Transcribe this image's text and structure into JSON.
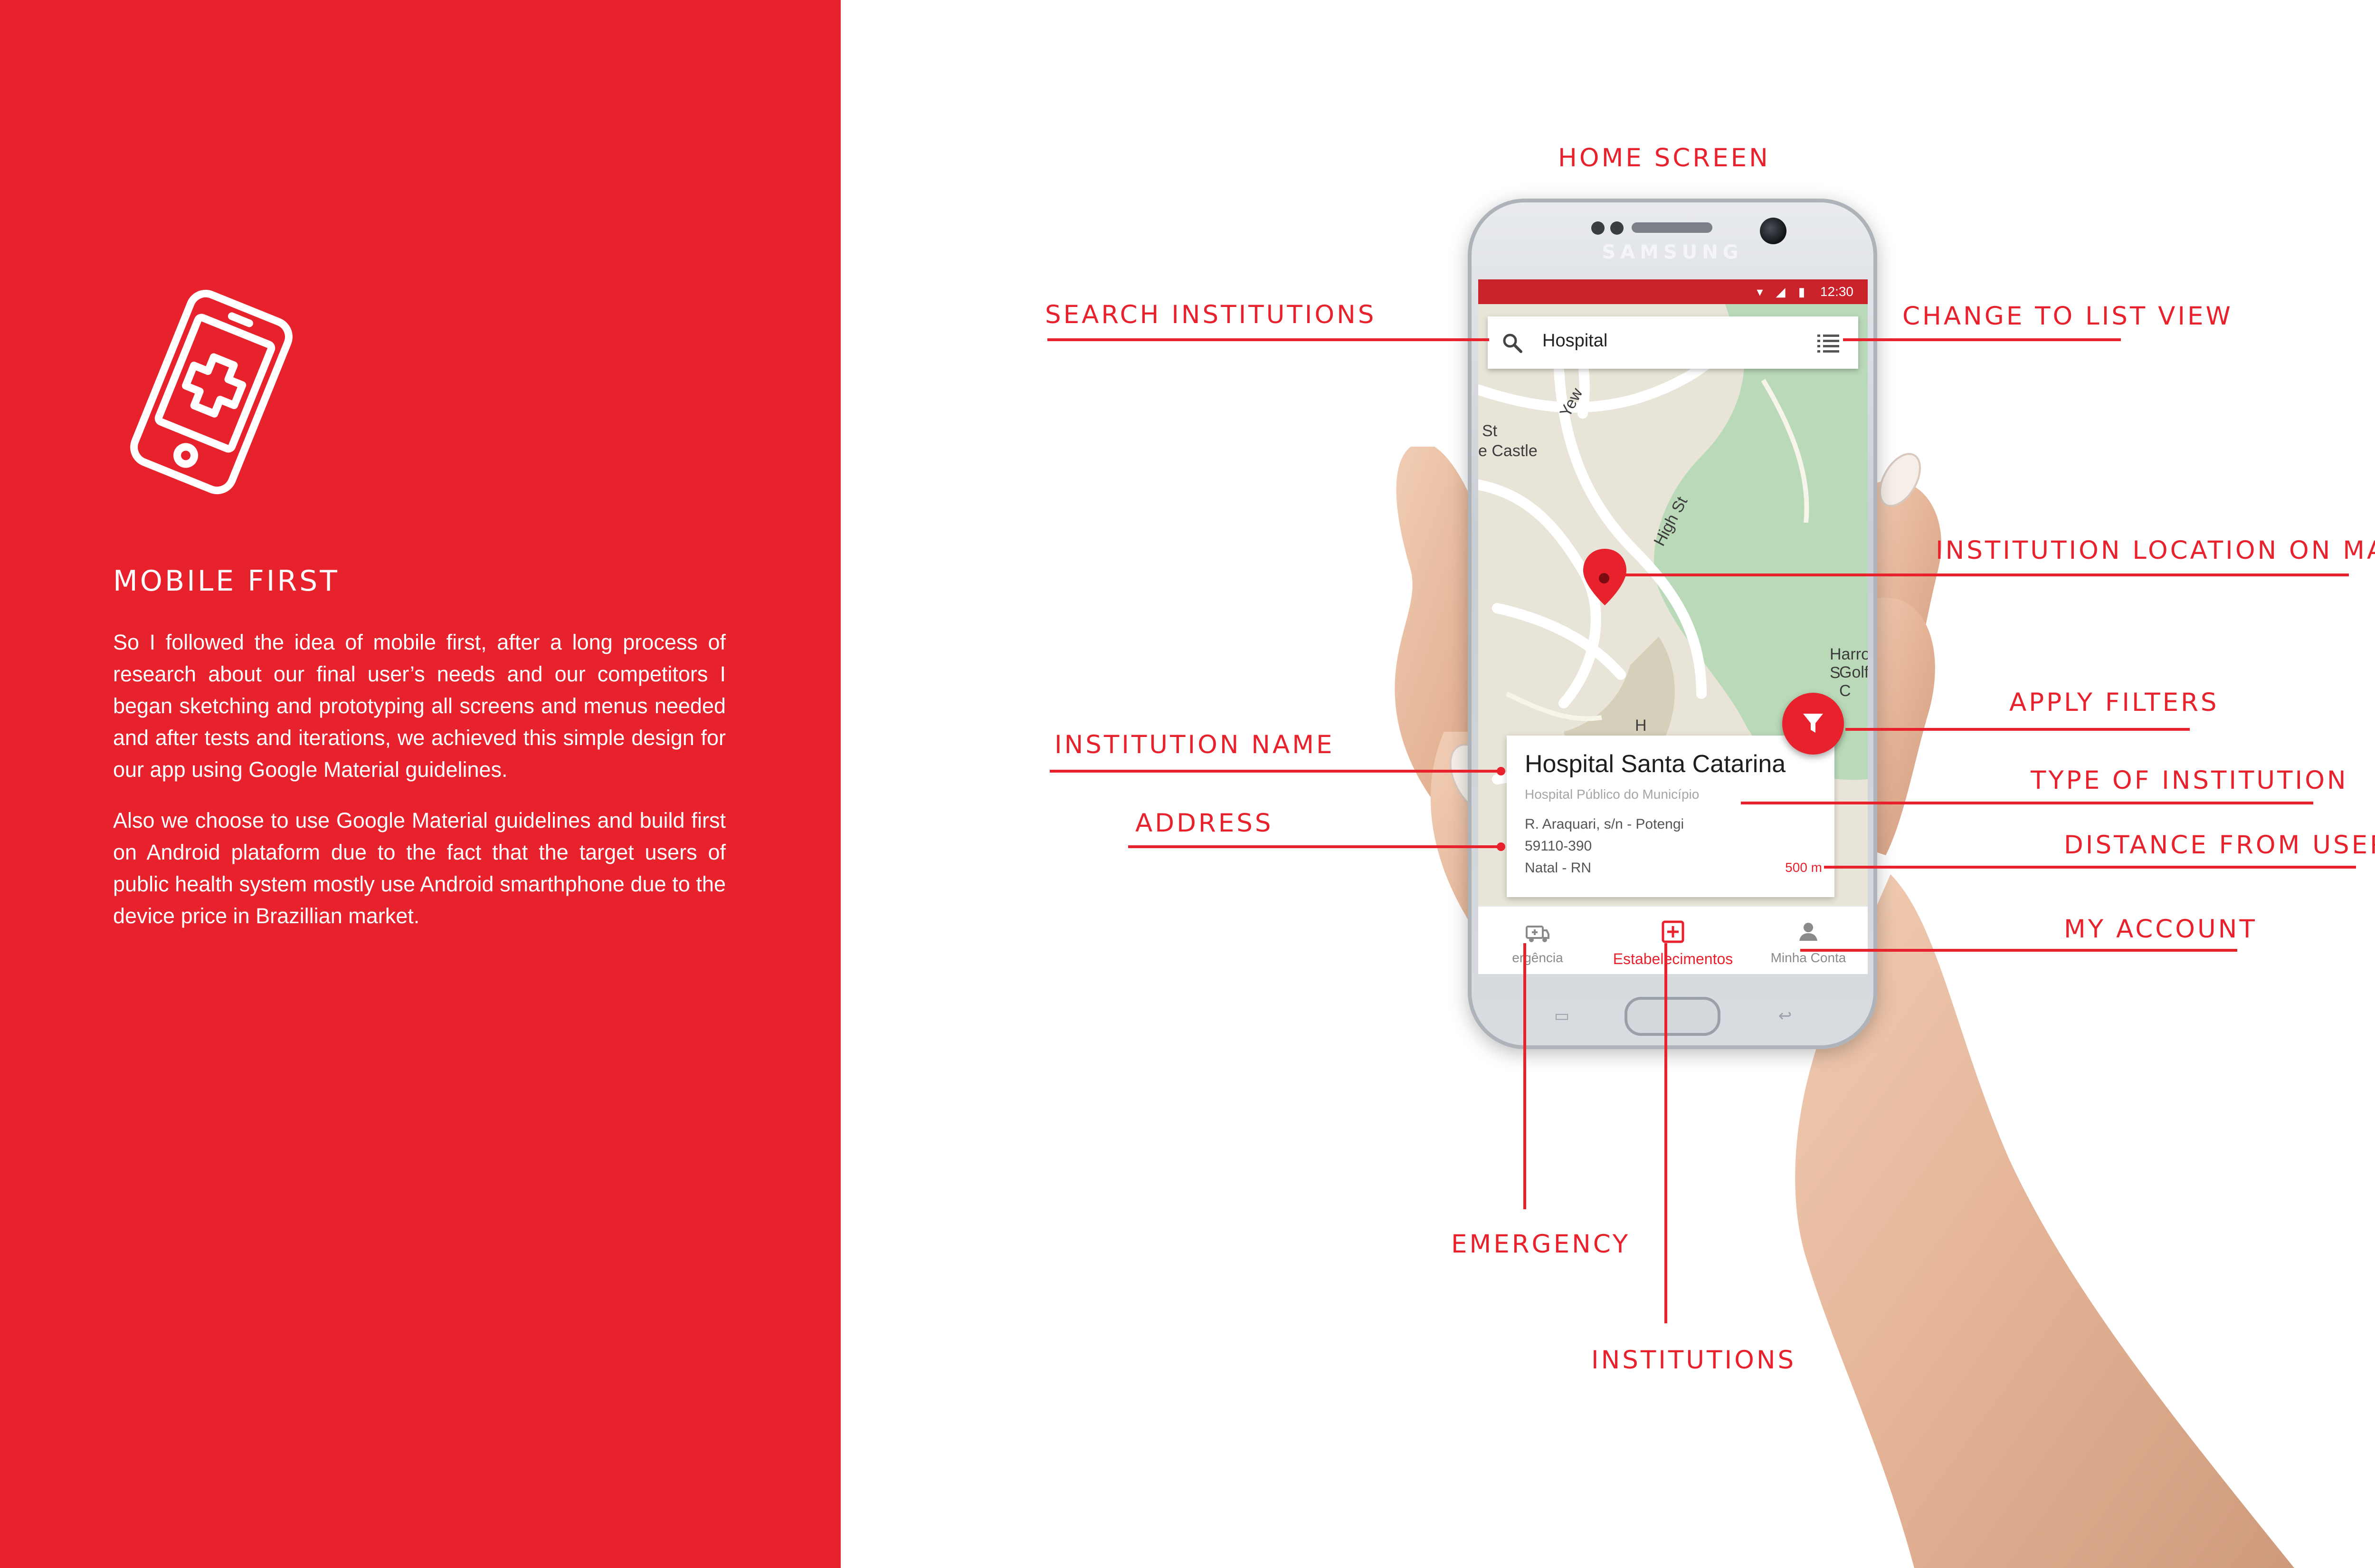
{
  "panel": {
    "heading": "MOBILE FIRST",
    "paragraphs": [
      "So I followed the idea of mobile first, after a long process of research about our final user’s needs and our competitors I began sketching and prototyping all screens and menus needed and after tests and iterations, we achieved this simple design for our app using Google Material guidelines.",
      "Also we choose to use Google Material guidelines and build first on Android plataform due to the fact that the target users of public health system mostly use Android smarthphone due to the device price in Brazillian market."
    ],
    "icon": "mobile-health-cross-icon"
  },
  "callouts": {
    "home_screen": "HOME SCREEN",
    "search_institutions": "SEARCH INSTITUTIONS",
    "change_to_list_view": "CHANGE TO LIST VIEW",
    "institution_location": "INSTITUTION LOCATION ON MAP",
    "apply_filters": "APPLY FILTERS",
    "institution_name": "INSTITUTION NAME",
    "type_of_institution": "TYPE OF INSTITUTION",
    "address": "ADDRESS",
    "distance_from_user": "DISTANCE FROM USER",
    "my_account": "MY ACCOUNT",
    "emergency": "EMERGENCY",
    "institutions": "INSTITUTIONS"
  },
  "phone": {
    "brand": "SAMSUNG",
    "status_time": "12:30",
    "status_icons": "▾ ◢ ▮",
    "search": {
      "value": "Hospital"
    },
    "map_labels": [
      "St",
      "e Castle",
      "Yew",
      "High St",
      "Harrow S",
      "Golf C",
      "H"
    ],
    "card": {
      "name": "Hospital Santa Catarina",
      "type": "Hospital Público do Município",
      "address_lines": [
        "R. Araquari, s/n - Potengi",
        "59110-390",
        "Natal - RN"
      ],
      "distance": "500 m"
    },
    "nav": [
      {
        "label": "ergência",
        "icon": "ambulance-icon"
      },
      {
        "label": "Estabelecimentos",
        "icon": "plus-box-icon"
      },
      {
        "label": "Minha Conta",
        "icon": "person-icon"
      }
    ]
  },
  "colors": {
    "brand_red": "#e8222d",
    "status_red": "#c9222a",
    "white": "#ffffff"
  }
}
